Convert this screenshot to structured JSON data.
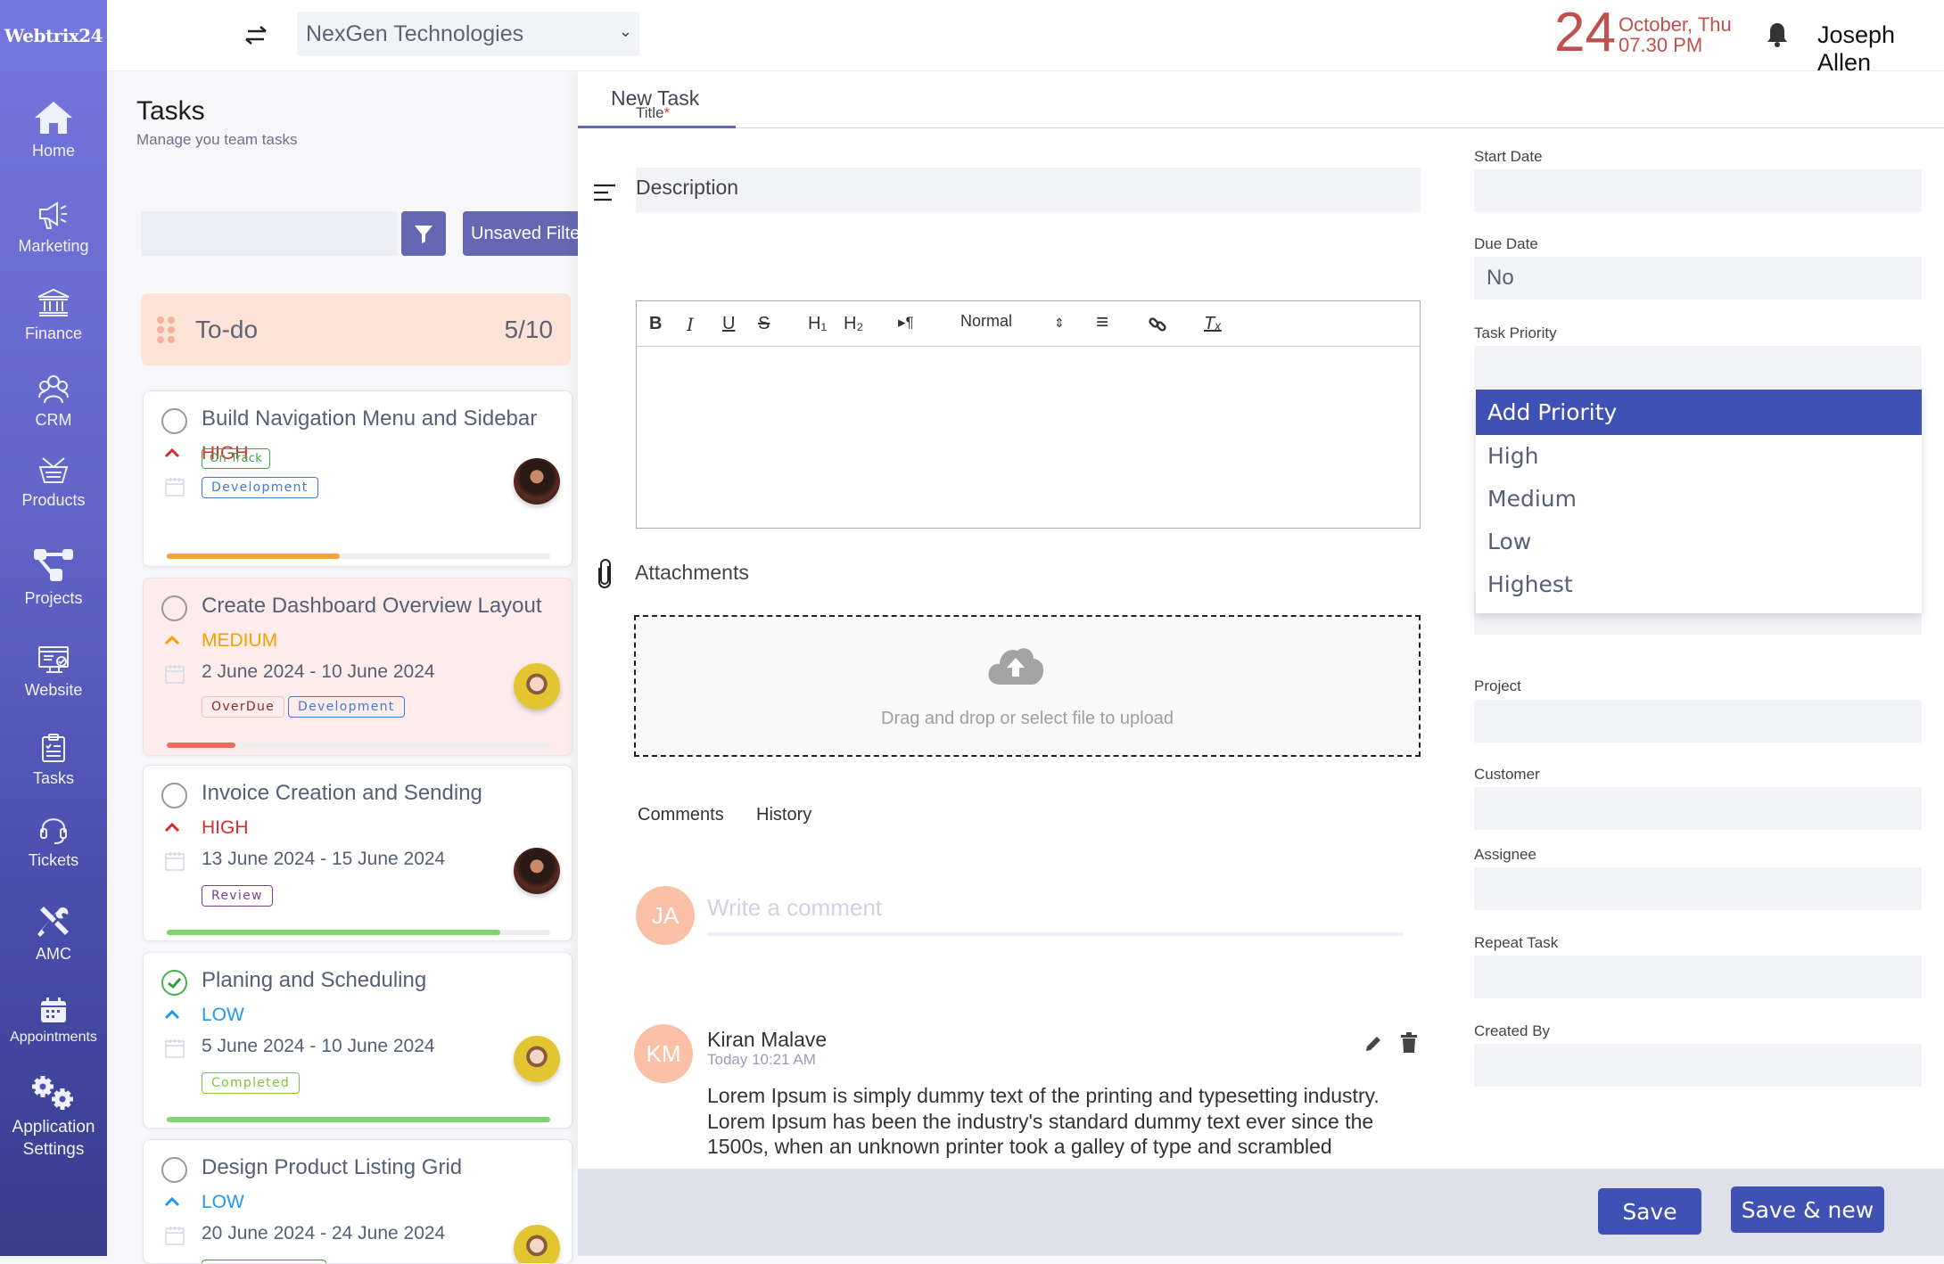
{
  "app": {
    "logo_text": "Webtrix24"
  },
  "sidebar": {
    "items": [
      {
        "label": "Home",
        "icon": "home-icon"
      },
      {
        "label": "Marketing",
        "icon": "megaphone-icon"
      },
      {
        "label": "Finance",
        "icon": "bank-icon"
      },
      {
        "label": "CRM",
        "icon": "people-icon"
      },
      {
        "label": "Products",
        "icon": "basket-icon"
      },
      {
        "label": "Projects",
        "icon": "project-tree-icon"
      },
      {
        "label": "Website",
        "icon": "website-icon"
      },
      {
        "label": "Tasks",
        "icon": "clipboard-icon"
      },
      {
        "label": "Tickets",
        "icon": "headset-icon"
      },
      {
        "label": "AMC",
        "icon": "tools-icon"
      },
      {
        "label": "Appointments",
        "icon": "calendar-icon"
      },
      {
        "label": "Application Settings",
        "icon": "gears-icon"
      }
    ]
  },
  "header": {
    "company": "NexGen Technologies",
    "date_day": "24",
    "date_month": "October, Thu",
    "time": "07.30 PM",
    "user_name": "Joseph Allen"
  },
  "tasks_panel": {
    "title": "Tasks",
    "subtitle": "Manage you team tasks",
    "search_value": "",
    "unsaved_filter_label": "Unsaved Filter",
    "column": {
      "label": "To-do",
      "count": "5/10"
    },
    "cards": [
      {
        "title": "Build Navigation Menu and Sidebar",
        "priority": "HIGH",
        "priority_color": "#d32f2f",
        "dates": "",
        "done": false,
        "overdue": false,
        "tags": [
          {
            "label": "On Track",
            "color": "#43a047"
          },
          {
            "label": "Development",
            "color": "#3f7bd1"
          }
        ],
        "progress": 0.45,
        "progress_color": "#f9a23c",
        "avatar": "dark"
      },
      {
        "title": "Create Dashboard Overview Layout",
        "priority": "MEDIUM",
        "priority_color": "#f5a000",
        "dates": "2 June 2024 - 10 June 2024",
        "done": false,
        "overdue": true,
        "tags": [
          {
            "label": "OverDue",
            "color": "#8b2a2a"
          },
          {
            "label": "Development",
            "color": "#3f7bd1"
          }
        ],
        "progress": 0.18,
        "progress_color": "#ef6b5e",
        "avatar": "yellow"
      },
      {
        "title": "Invoice Creation and Sending",
        "priority": "HIGH",
        "priority_color": "#d32f2f",
        "dates": "13 June 2024 - 15 June 2024",
        "done": false,
        "overdue": false,
        "tags": [
          {
            "label": "Review",
            "color": "#7b3f98"
          }
        ],
        "progress": 0.87,
        "progress_color": "#7ed66d",
        "avatar": "dark"
      },
      {
        "title": "Planing and Scheduling",
        "priority": "LOW",
        "priority_color": "#2196f3",
        "dates": "5 June 2024 - 10 June 2024",
        "done": true,
        "overdue": false,
        "tags": [
          {
            "label": "Completed",
            "color": "#7cc43a"
          }
        ],
        "progress": 1.0,
        "progress_color": "#7ed66d",
        "avatar": "yellow"
      },
      {
        "title": "Design Product Listing Grid",
        "priority": "LOW",
        "priority_color": "#2196f3",
        "dates": "20 June 2024 - 24 June 2024",
        "done": false,
        "overdue": false,
        "tags": [],
        "progress": 0,
        "progress_color": "#7ed66d",
        "avatar": "yellow"
      }
    ]
  },
  "form": {
    "tab_label": "New Task",
    "title_label": "Title",
    "title_required": "*",
    "title_value": "",
    "description_label": "Description",
    "toolbar": {
      "bold": "B",
      "italic": "I",
      "underline": "U",
      "strike": "S",
      "h1": "H₁",
      "h2": "H₂",
      "direction": "▸¶",
      "format_select": "Normal",
      "align": "≡",
      "clear": "Tₓ"
    },
    "attachments_label": "Attachments",
    "dropzone_text": "Drag and drop or select file to upload",
    "comment_tabs": [
      "Comments",
      "History"
    ],
    "comment_placeholder": "Write a comment",
    "current_user_initials": "JA",
    "comments": [
      {
        "initials": "KM",
        "author": "Kiran Malave",
        "time": "Today 10:21 AM",
        "text": "Lorem Ipsum is simply dummy text of the printing and  typesetting industry. Lorem Ipsum has been the industry's standard dummy  text ever since the 1500s, when an unknown printer took a galley of  type and scrambled"
      }
    ]
  },
  "fields": {
    "start_date": {
      "label": "Start Date",
      "value": ""
    },
    "due_date": {
      "label": "Due Date",
      "value": "No"
    },
    "task_priority": {
      "label": "Task Priority",
      "value": ""
    },
    "project": {
      "label": "Project",
      "value": ""
    },
    "customer": {
      "label": "Customer",
      "value": ""
    },
    "assignee": {
      "label": "Assignee",
      "value": ""
    },
    "repeat_task": {
      "label": "Repeat Task",
      "value": ""
    },
    "created_by": {
      "label": "Created By",
      "value": ""
    }
  },
  "priority_dropdown": {
    "options": [
      "Add Priority",
      "High",
      "Medium",
      "Low",
      "Highest"
    ],
    "highlighted": "Add Priority"
  },
  "footer": {
    "save_label": "Save",
    "save_new_label": "Save & new"
  },
  "colors": {
    "sidebar_top": "#7476de",
    "sidebar_bottom": "#383c8c",
    "primary": "#3f51b5",
    "filter_button": "#6567b3",
    "date_accent": "#c0504d",
    "todo_header_bg": "#fde3d6"
  }
}
